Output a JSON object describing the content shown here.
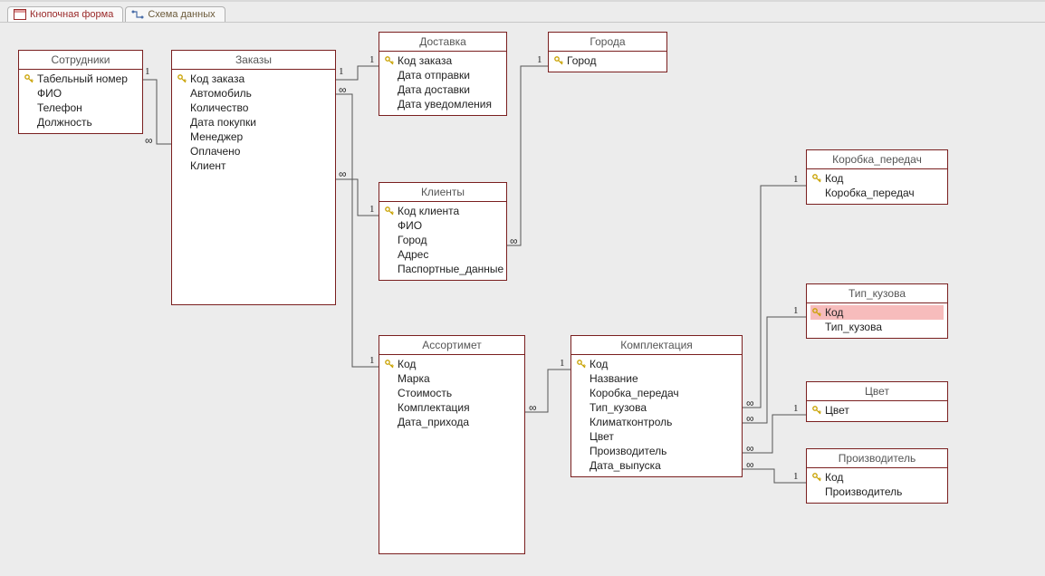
{
  "tabs": {
    "inactive": "Кнопочная форма",
    "active": "Схема данных"
  },
  "tables": {
    "employees": {
      "title": "Сотрудники",
      "fields": [
        {
          "key": true,
          "name": "Табельный номер"
        },
        {
          "key": false,
          "name": "ФИО"
        },
        {
          "key": false,
          "name": "Телефон"
        },
        {
          "key": false,
          "name": "Должность"
        }
      ]
    },
    "orders": {
      "title": "Заказы",
      "fields": [
        {
          "key": true,
          "name": "Код заказа"
        },
        {
          "key": false,
          "name": "Автомобиль"
        },
        {
          "key": false,
          "name": "Количество"
        },
        {
          "key": false,
          "name": "Дата покупки"
        },
        {
          "key": false,
          "name": "Менеджер"
        },
        {
          "key": false,
          "name": "Оплачено"
        },
        {
          "key": false,
          "name": "Клиент"
        }
      ]
    },
    "delivery": {
      "title": "Доставка",
      "fields": [
        {
          "key": true,
          "name": "Код заказа"
        },
        {
          "key": false,
          "name": "Дата отправки"
        },
        {
          "key": false,
          "name": "Дата доставки"
        },
        {
          "key": false,
          "name": "Дата уведомления"
        }
      ]
    },
    "cities": {
      "title": "Города",
      "fields": [
        {
          "key": true,
          "name": "Город"
        }
      ]
    },
    "clients": {
      "title": "Клиенты",
      "fields": [
        {
          "key": true,
          "name": "Код клиента"
        },
        {
          "key": false,
          "name": "ФИО"
        },
        {
          "key": false,
          "name": "Город"
        },
        {
          "key": false,
          "name": "Адрес"
        },
        {
          "key": false,
          "name": "Паспортные_данные"
        }
      ]
    },
    "assortment": {
      "title": "Ассортимет",
      "fields": [
        {
          "key": true,
          "name": "Код"
        },
        {
          "key": false,
          "name": "Марка"
        },
        {
          "key": false,
          "name": "Стоимость"
        },
        {
          "key": false,
          "name": "Комплектация"
        },
        {
          "key": false,
          "name": "Дата_прихода"
        }
      ]
    },
    "complectation": {
      "title": "Комплектация",
      "fields": [
        {
          "key": true,
          "name": "Код"
        },
        {
          "key": false,
          "name": "Название"
        },
        {
          "key": false,
          "name": "Коробка_передач"
        },
        {
          "key": false,
          "name": "Тип_кузова"
        },
        {
          "key": false,
          "name": "Климатконтроль"
        },
        {
          "key": false,
          "name": "Цвет"
        },
        {
          "key": false,
          "name": "Производитель"
        },
        {
          "key": false,
          "name": "Дата_выпуска"
        }
      ]
    },
    "gearbox": {
      "title": "Коробка_передач",
      "fields": [
        {
          "key": true,
          "name": "Код"
        },
        {
          "key": false,
          "name": "Коробка_передач"
        }
      ]
    },
    "bodytype": {
      "title": "Тип_кузова",
      "fields": [
        {
          "key": true,
          "name": "Код",
          "selected": true
        },
        {
          "key": false,
          "name": "Тип_кузова"
        }
      ]
    },
    "color": {
      "title": "Цвет",
      "fields": [
        {
          "key": true,
          "name": "Цвет"
        }
      ]
    },
    "manufacturer": {
      "title": "Производитель",
      "fields": [
        {
          "key": true,
          "name": "Код"
        },
        {
          "key": false,
          "name": "Производитель"
        }
      ]
    }
  },
  "rel_labels": {
    "one": "1",
    "many": "∞"
  }
}
